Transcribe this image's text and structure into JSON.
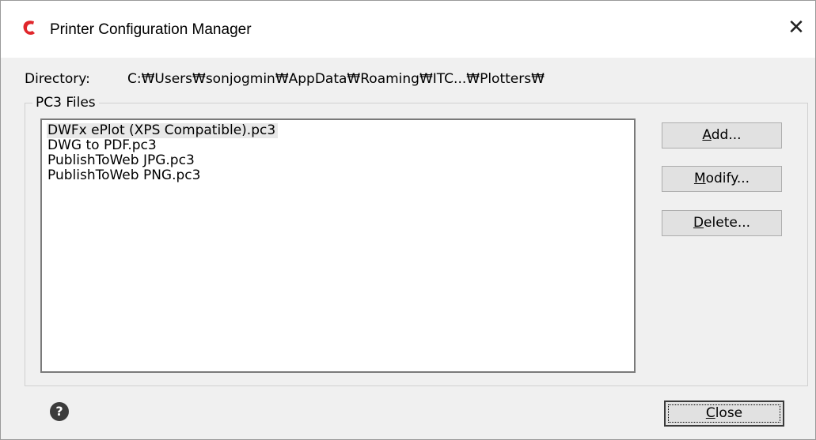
{
  "window": {
    "title": "Printer Configuration Manager",
    "close_glyph": "✕"
  },
  "directory": {
    "label": "Directory:",
    "path": "C:₩Users₩sonjogmin₩AppData₩Roaming₩ITC...₩Plotters₩"
  },
  "pc3_group": {
    "legend": "PC3 Files",
    "files": [
      "DWFx ePlot (XPS Compatible).pc3",
      "DWG to PDF.pc3",
      "PublishToWeb JPG.pc3",
      "PublishToWeb PNG.pc3"
    ],
    "selected_index": 0
  },
  "buttons": {
    "add": {
      "mnemonic": "A",
      "rest": "dd..."
    },
    "modify": {
      "mnemonic": "M",
      "rest": "odify..."
    },
    "delete": {
      "mnemonic": "D",
      "rest": "elete..."
    },
    "close": {
      "mnemonic": "C",
      "rest": "lose"
    }
  },
  "icons": {
    "app": "app-logo-icon",
    "help": "help-icon",
    "help_glyph": "?"
  },
  "colors": {
    "app_icon": "#e0262b",
    "selection": "#e8e8e8"
  }
}
